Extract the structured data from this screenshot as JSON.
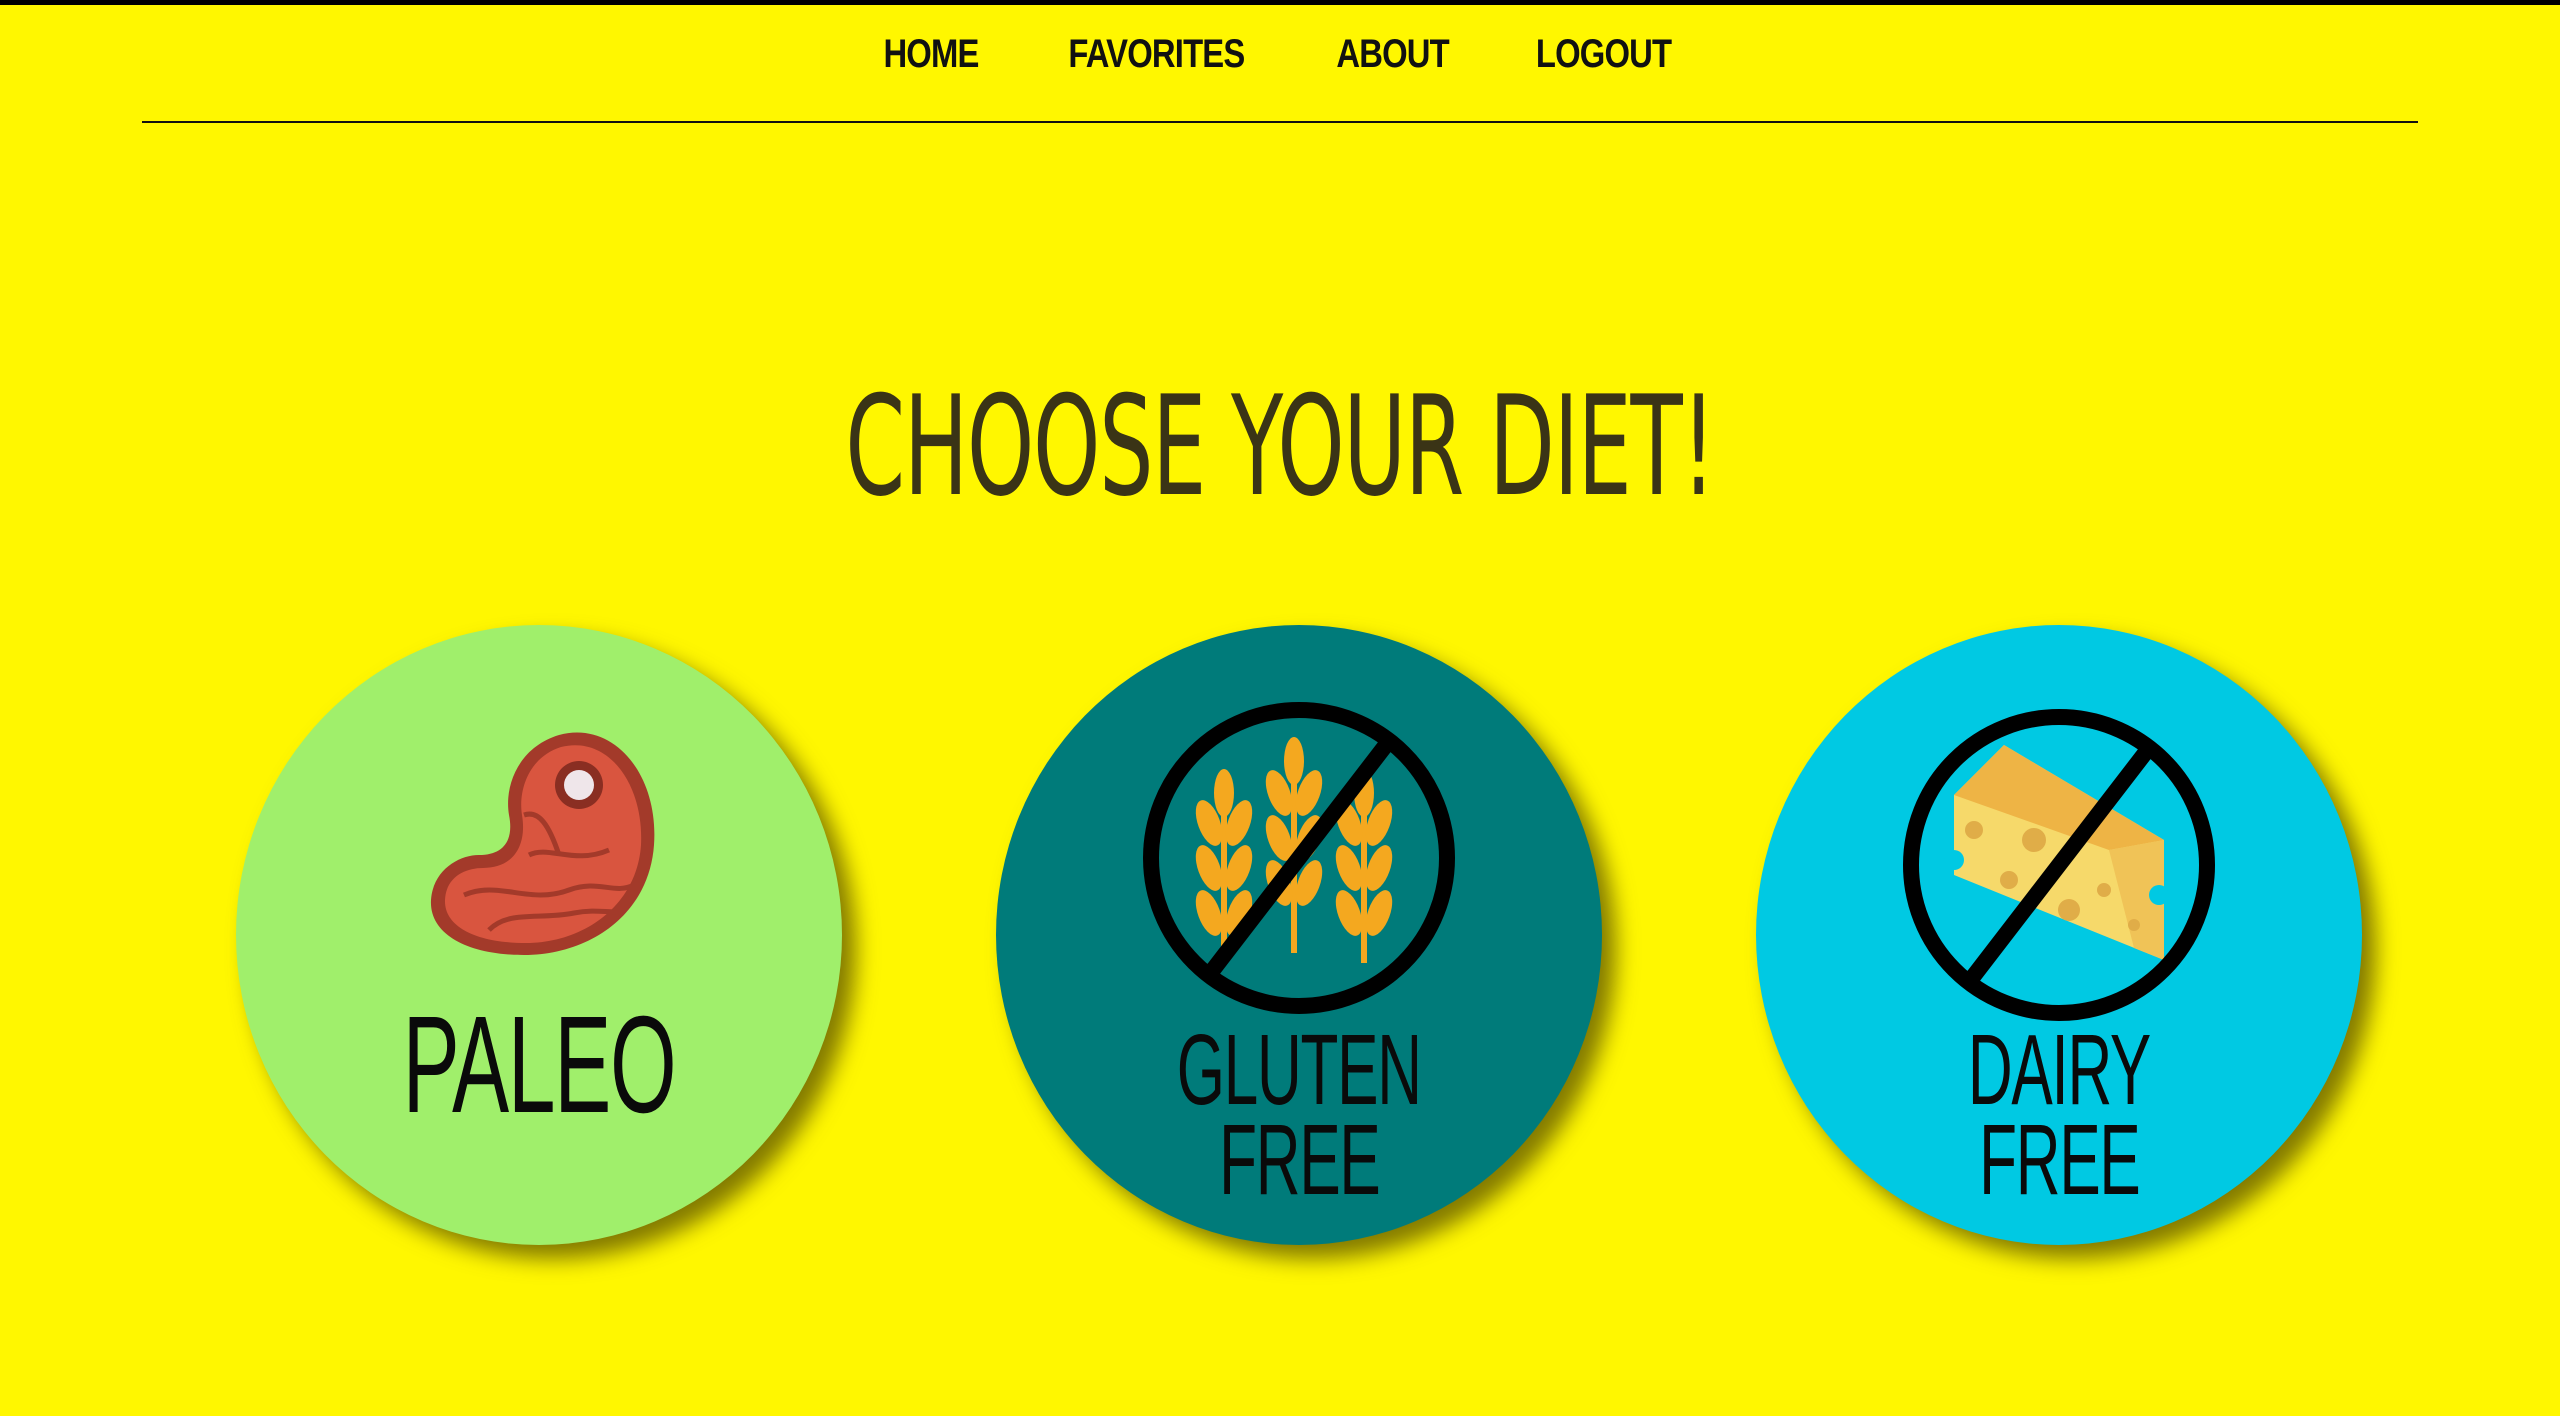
{
  "nav": {
    "items": [
      "HOME",
      "FAVORITES",
      "ABOUT",
      "LOGOUT"
    ]
  },
  "heading": "CHOOSE YOUR DIET!",
  "diets": [
    {
      "line1": "PALEO",
      "line2": "",
      "icon": "meat-steak-icon",
      "color": "#a0ef6b"
    },
    {
      "line1": "GLUTEN",
      "line2": "FREE",
      "icon": "no-wheat-icon",
      "color": "#007b7a"
    },
    {
      "line1": "DAIRY",
      "line2": "FREE",
      "icon": "no-cheese-icon",
      "color": "#00c9e3"
    }
  ],
  "colors": {
    "background": "#fff700",
    "text": "#111111"
  }
}
